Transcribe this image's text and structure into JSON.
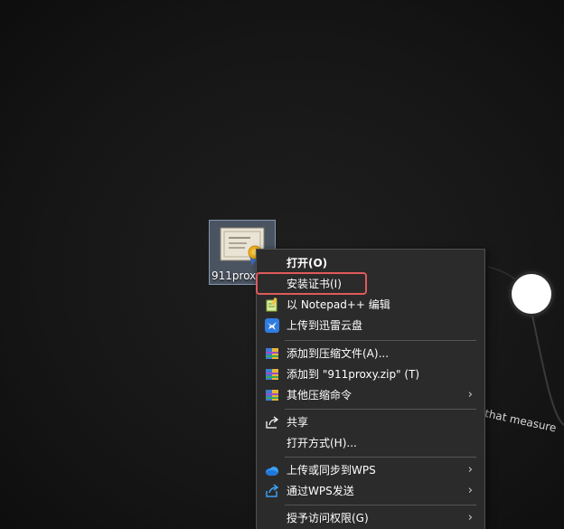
{
  "desktop": {
    "wallpaper_text": "that measure",
    "file": {
      "label": "911prox",
      "icon": "certificate-file-icon"
    }
  },
  "context_menu": {
    "items": [
      {
        "label": "打开(O)",
        "icon": "",
        "bold": true
      },
      {
        "label": "安装证书(I)",
        "icon": "",
        "highlighted": true
      },
      {
        "label": "以 Notepad++ 编辑",
        "icon": "notepad-plus-plus-icon"
      },
      {
        "label": "上传到迅雷云盘",
        "icon": "thunder-cloud-icon"
      },
      {
        "label": "添加到压缩文件(A)...",
        "icon": "winrar-archive-icon"
      },
      {
        "label": "添加到 \"911proxy.zip\" (T)",
        "icon": "winrar-archive-icon"
      },
      {
        "label": "其他压缩命令",
        "icon": "winrar-archive-icon",
        "submenu": true
      },
      {
        "label": "共享",
        "icon": "share-icon"
      },
      {
        "label": "打开方式(H)...",
        "icon": ""
      },
      {
        "label": "上传或同步到WPS",
        "icon": "wps-cloud-icon",
        "submenu": true
      },
      {
        "label": "通过WPS发送",
        "icon": "wps-send-icon",
        "submenu": true
      },
      {
        "label": "授予访问权限(G)",
        "icon": "",
        "submenu": true
      }
    ]
  },
  "colors": {
    "menu_background": "#2b2b2b",
    "highlight_border": "#e05a5a",
    "text": "#ffffff"
  }
}
